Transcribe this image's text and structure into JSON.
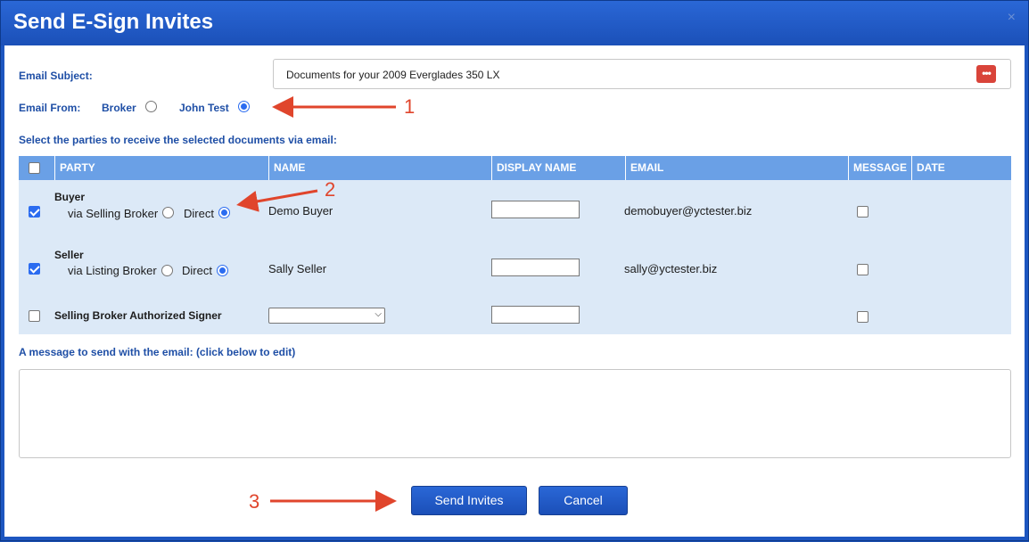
{
  "dialog": {
    "title": "Send E-Sign Invites",
    "close_glyph": "×"
  },
  "email_subject": {
    "label": "Email Subject:",
    "value": "Documents for your 2009 Everglades 350 LX",
    "action_icon": "more-dots-icon"
  },
  "email_from": {
    "label": "Email From:",
    "options": [
      {
        "label": "Broker",
        "selected": false
      },
      {
        "label": "John Test",
        "selected": true
      }
    ]
  },
  "parties_instruction": "Select the parties to receive the selected documents via email:",
  "table": {
    "columns": [
      "PARTY",
      "NAME",
      "DISPLAY NAME",
      "EMAIL",
      "MESSAGE",
      "DATE"
    ],
    "rows": [
      {
        "checked": true,
        "party": "Buyer",
        "via_label": "via Selling Broker",
        "direct_label": "Direct",
        "direct_selected": true,
        "name": "Demo Buyer",
        "display_name": "",
        "email": "demobuyer@yctester.biz",
        "message_checked": false
      },
      {
        "checked": true,
        "party": "Seller",
        "via_label": "via Listing Broker",
        "direct_label": "Direct",
        "direct_selected": true,
        "name": "Sally Seller",
        "display_name": "",
        "email": "sally@yctester.biz",
        "message_checked": false
      },
      {
        "checked": false,
        "party": "Selling Broker Authorized Signer",
        "name_select_value": "",
        "display_name": "",
        "email": "",
        "message_checked": false
      }
    ]
  },
  "message": {
    "label": "A message to send with the email: (click below to edit)",
    "value": ""
  },
  "buttons": {
    "send": "Send Invites",
    "cancel": "Cancel"
  },
  "annotations": {
    "n1": "1",
    "n2": "2",
    "n3": "3"
  },
  "colors": {
    "brand": "#1d56c0",
    "header": "#6aa0e6",
    "rows": "#dce9f7",
    "annotation": "#e0452c"
  }
}
